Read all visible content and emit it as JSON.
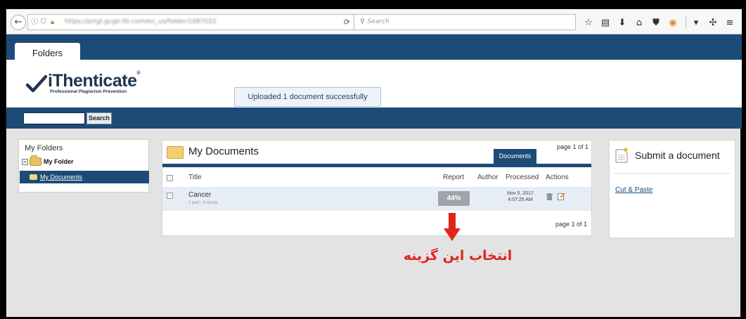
{
  "browser": {
    "url": "https://prtgl.gcge-lib.com/en_us/folder/1087022",
    "search_placeholder": "Search"
  },
  "app": {
    "tab_label": "Folders",
    "brand_name": "iThenticate",
    "brand_mark": "®",
    "tagline": "Professional Plagiarism Prevention",
    "flash_message": "Uploaded 1 document successfully",
    "search_button": "Search",
    "search_value": ""
  },
  "sidebar": {
    "header": "My Folders",
    "folder": "My Folder",
    "selected_item": "My Documents"
  },
  "documents": {
    "title": "My Documents",
    "tab": "Documents",
    "page_top": "page 1 of 1",
    "page_bottom": "page 1 of 1",
    "columns": [
      "Title",
      "Report",
      "Author",
      "Processed",
      "Actions"
    ],
    "rows": [
      {
        "title": "Cancer",
        "subtitle": "1 part - 0 words",
        "report": "44%",
        "author": "",
        "processed_date": "Nov 5, 2017",
        "processed_time": "4:07:25 AM"
      }
    ]
  },
  "annotation": {
    "text": "انتخاب این گزینه",
    "color": "#e0261c"
  },
  "submit_panel": {
    "title": "Submit a document",
    "link": "Cut & Paste"
  },
  "colors": {
    "brand_blue": "#1c4b78",
    "report_badge": "#9ea4a9"
  }
}
